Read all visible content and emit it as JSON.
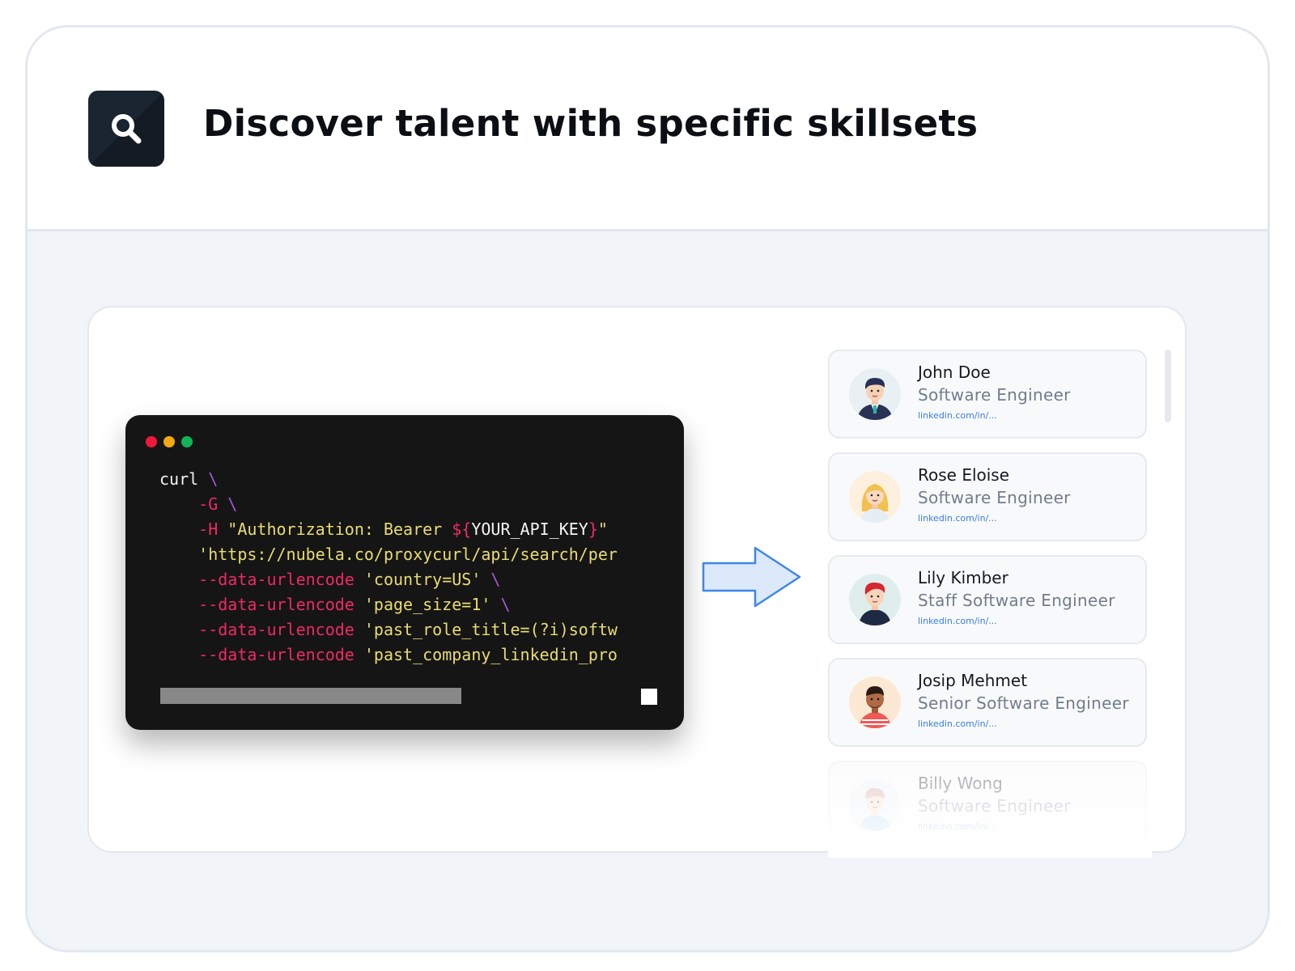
{
  "header": {
    "title": "Discover talent with specific skillsets",
    "icon": "search-icon"
  },
  "terminal": {
    "window_dots": [
      "#f0183c",
      "#f5a90f",
      "#12b45a"
    ],
    "lines": [
      [
        {
          "t": "curl ",
          "c": "white"
        },
        {
          "t": "\\",
          "c": "purple"
        }
      ],
      [
        {
          "t": "    -G ",
          "c": "red"
        },
        {
          "t": "\\",
          "c": "purple"
        }
      ],
      [
        {
          "t": "    -H ",
          "c": "red"
        },
        {
          "t": "\"Authorization: Bearer ",
          "c": "yellow"
        },
        {
          "t": "${",
          "c": "red"
        },
        {
          "t": "YOUR_API_KEY",
          "c": "white"
        },
        {
          "t": "}",
          "c": "red"
        },
        {
          "t": "\"",
          "c": "yellow"
        }
      ],
      [
        {
          "t": "    'https://nubela.co/proxycurl/api/search/per",
          "c": "yellow"
        }
      ],
      [
        {
          "t": "    --data-urlencode ",
          "c": "red"
        },
        {
          "t": "'country=US' ",
          "c": "yellow"
        },
        {
          "t": "\\",
          "c": "purple"
        }
      ],
      [
        {
          "t": "    --data-urlencode ",
          "c": "red"
        },
        {
          "t": "'page_size=1' ",
          "c": "yellow"
        },
        {
          "t": "\\",
          "c": "purple"
        }
      ],
      [
        {
          "t": "    --data-urlencode ",
          "c": "red"
        },
        {
          "t": "'past_role_title=(?i)softw",
          "c": "yellow"
        }
      ],
      [
        {
          "t": "    --data-urlencode ",
          "c": "red"
        },
        {
          "t": "'past_company_linkedin_pro",
          "c": "yellow"
        }
      ]
    ]
  },
  "profiles": [
    {
      "name": "John Doe",
      "role": "Software Engineer",
      "link": "linkedin.com/in/...",
      "avatar": "avatar-john"
    },
    {
      "name": "Rose Eloise",
      "role": "Software Engineer",
      "link": "linkedin.com/in/...",
      "avatar": "avatar-rose"
    },
    {
      "name": "Lily Kimber",
      "role": "Staff Software Engineer",
      "link": "linkedin.com/in/...",
      "avatar": "avatar-lily"
    },
    {
      "name": "Josip Mehmet",
      "role": "Senior Software Engineer",
      "link": "linkedin.com/in/...",
      "avatar": "avatar-josip"
    },
    {
      "name": "Billy Wong",
      "role": "Software Engineer",
      "link": "linkedin.com/in/...",
      "avatar": "avatar-billy"
    }
  ]
}
